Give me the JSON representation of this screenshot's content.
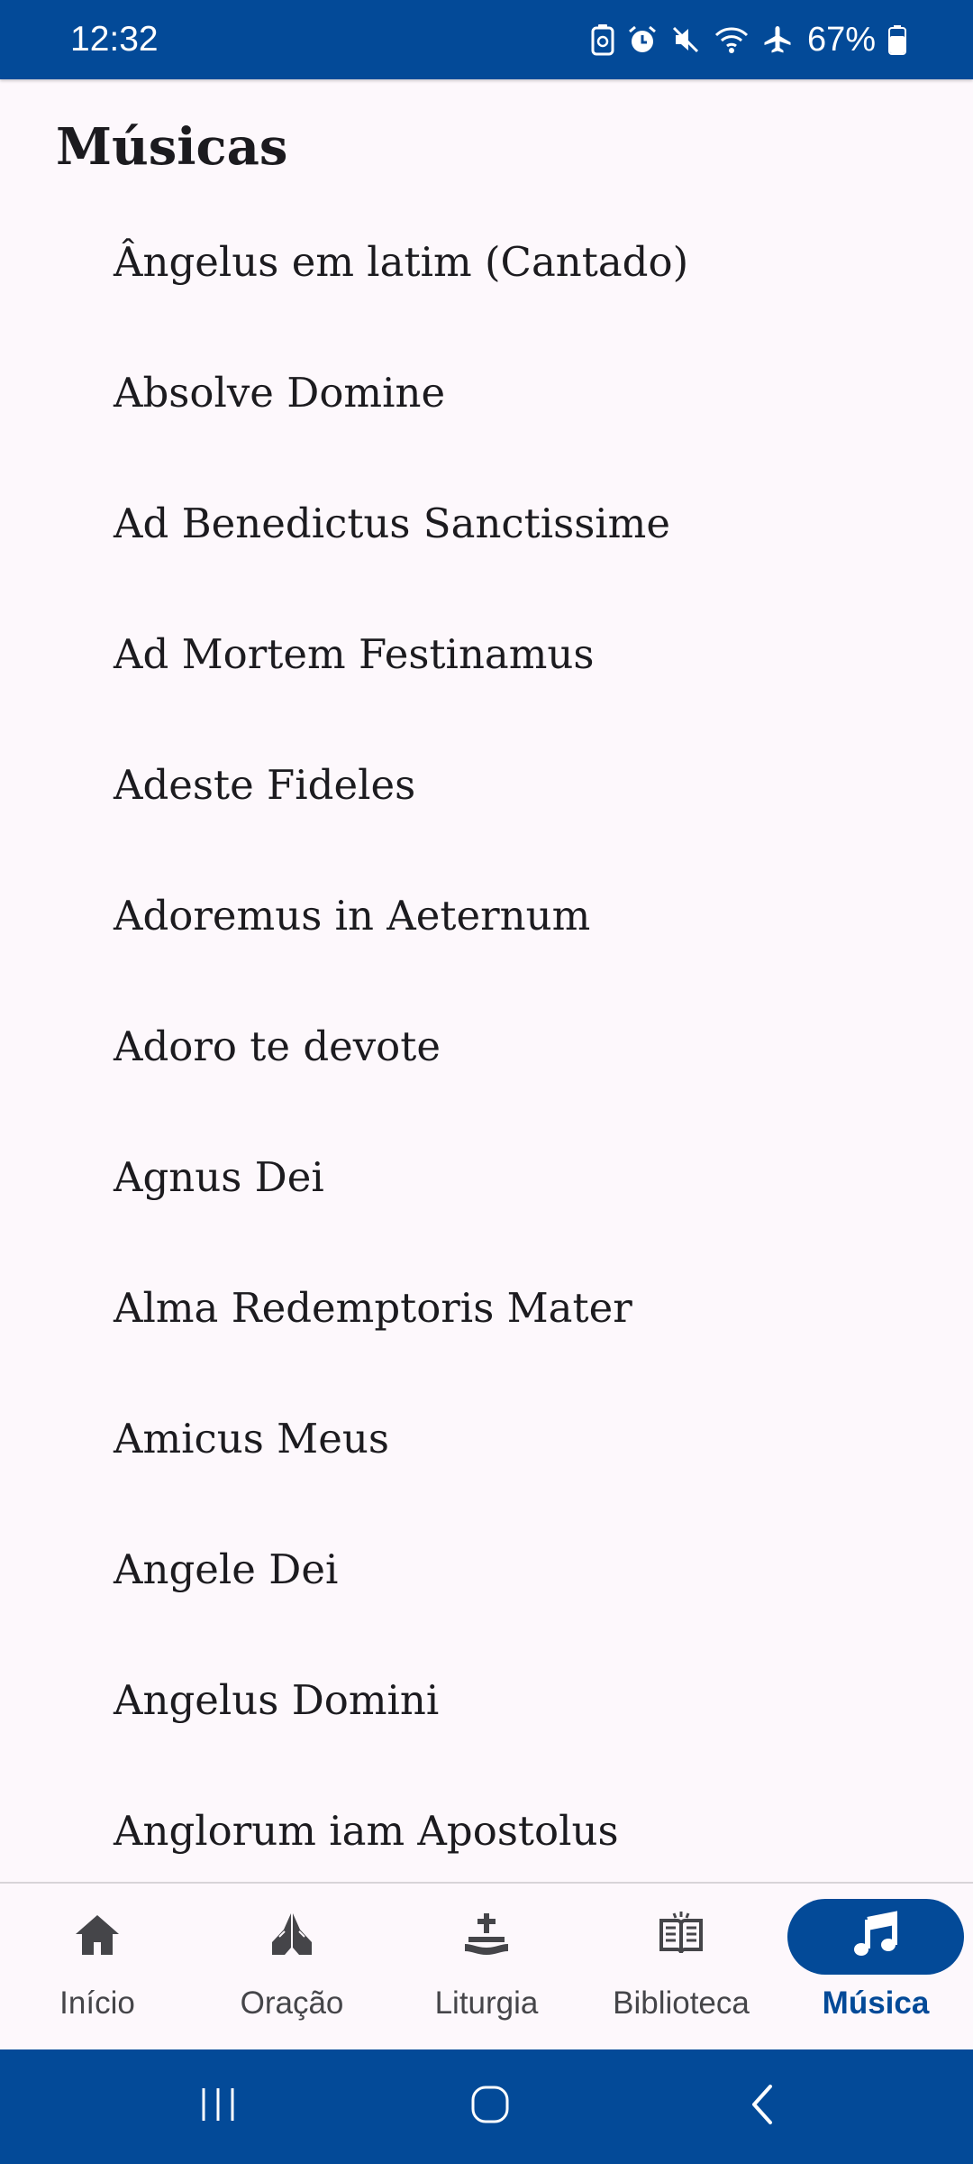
{
  "status_bar": {
    "time": "12:32",
    "battery": "67%",
    "icons": [
      "battery-saver-icon",
      "alarm-icon",
      "mute-icon",
      "wifi-icon",
      "airplane-icon",
      "battery-icon"
    ]
  },
  "page": {
    "title": "Músicas"
  },
  "songs": [
    "Ângelus em latim (Cantado)",
    "Absolve Domine",
    "Ad Benedictus Sanctissime",
    "Ad Mortem Festinamus",
    "Adeste Fideles",
    "Adoremus in Aeternum",
    "Adoro te devote",
    "Agnus Dei",
    "Alma Redemptoris Mater",
    "Amicus Meus",
    "Angele Dei",
    "Angelus Domini",
    "Anglorum iam Apostolus"
  ],
  "bottom_nav": {
    "items": [
      {
        "label": "Início",
        "icon": "home-icon",
        "active": false
      },
      {
        "label": "Oração",
        "icon": "praying-hands-icon",
        "active": false
      },
      {
        "label": "Liturgia",
        "icon": "church-icon",
        "active": false
      },
      {
        "label": "Biblioteca",
        "icon": "book-icon",
        "active": false
      },
      {
        "label": "Música",
        "icon": "music-note-icon",
        "active": true
      }
    ]
  },
  "system_nav": {
    "icons": [
      "recents-icon",
      "home-circle-icon",
      "back-icon"
    ]
  },
  "colors": {
    "primary": "#034a98",
    "background": "#fdf8fc",
    "text": "#1c1b1f",
    "nav_inactive": "#454549"
  }
}
